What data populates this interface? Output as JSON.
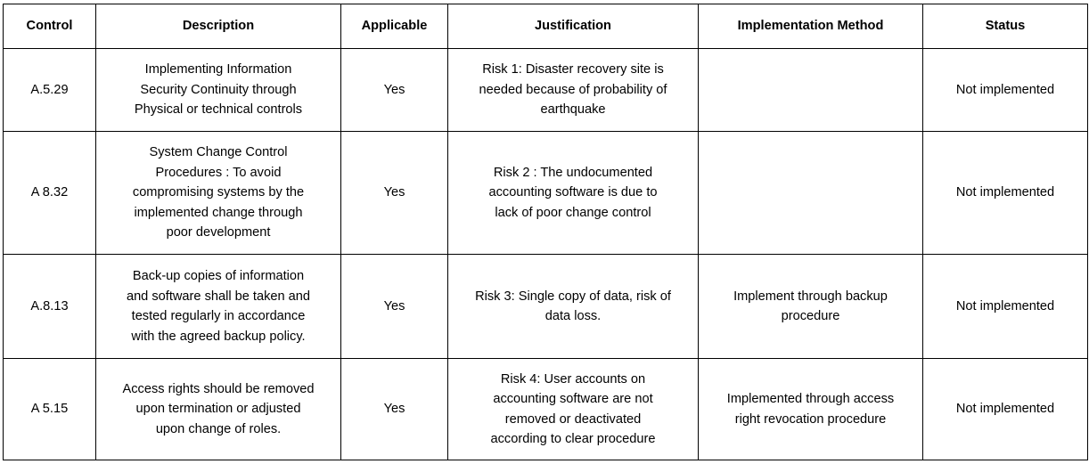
{
  "headers": [
    "Control",
    "Description",
    "Applicable",
    "Justification",
    "Implementation Method",
    "Status"
  ],
  "rows": [
    {
      "control": "A.5.29",
      "description": "Implementing Information\nSecurity Continuity through\nPhysical or technical controls",
      "applicable": "Yes",
      "justification": "Risk 1: Disaster recovery site is\nneeded because of probability of\nearthquake",
      "method": "",
      "status": "Not implemented"
    },
    {
      "control": "A 8.32",
      "description": "System Change Control\nProcedures : To avoid\ncompromising systems by the\nimplemented change through\npoor development",
      "applicable": "Yes",
      "justification": "Risk 2 : The undocumented\naccounting software is due to\nlack of poor change control",
      "method": "",
      "status": "Not implemented"
    },
    {
      "control": "A.8.13",
      "description": "Back-up copies of information\nand software shall be taken and\ntested regularly in accordance\nwith the agreed backup policy.",
      "applicable": "Yes",
      "justification": "Risk 3: Single copy of data, risk of\ndata loss.",
      "method": "Implement through backup\nprocedure",
      "status": "Not implemented"
    },
    {
      "control": "A 5.15",
      "description": "Access rights should be removed\nupon termination or adjusted\nupon change of roles.",
      "applicable": "Yes",
      "justification": "Risk 4: User accounts on\naccounting software are not\nremoved or deactivated\naccording to clear procedure",
      "method": "Implemented through access\nright revocation  procedure",
      "status": "Not implemented"
    }
  ]
}
